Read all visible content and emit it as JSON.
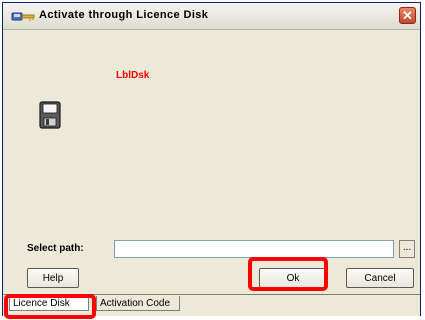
{
  "window": {
    "title": "Activate through Licence Disk",
    "close_glyph": "✕"
  },
  "content": {
    "dynamic_label": "LblDsk",
    "disk_icon": "floppy-disk-icon"
  },
  "path": {
    "label": "Select path:",
    "value": "",
    "browse_label": "..."
  },
  "buttons": {
    "help": "Help",
    "ok": "Ok",
    "cancel": "Cancel"
  },
  "tabs": [
    {
      "label": "Licence Disk",
      "active": true
    },
    {
      "label": "Activation Code",
      "active": false
    }
  ],
  "colors": {
    "label_red": "#ff0000",
    "highlight": "#ff0000",
    "dialog_bg": "#ece9d8"
  }
}
